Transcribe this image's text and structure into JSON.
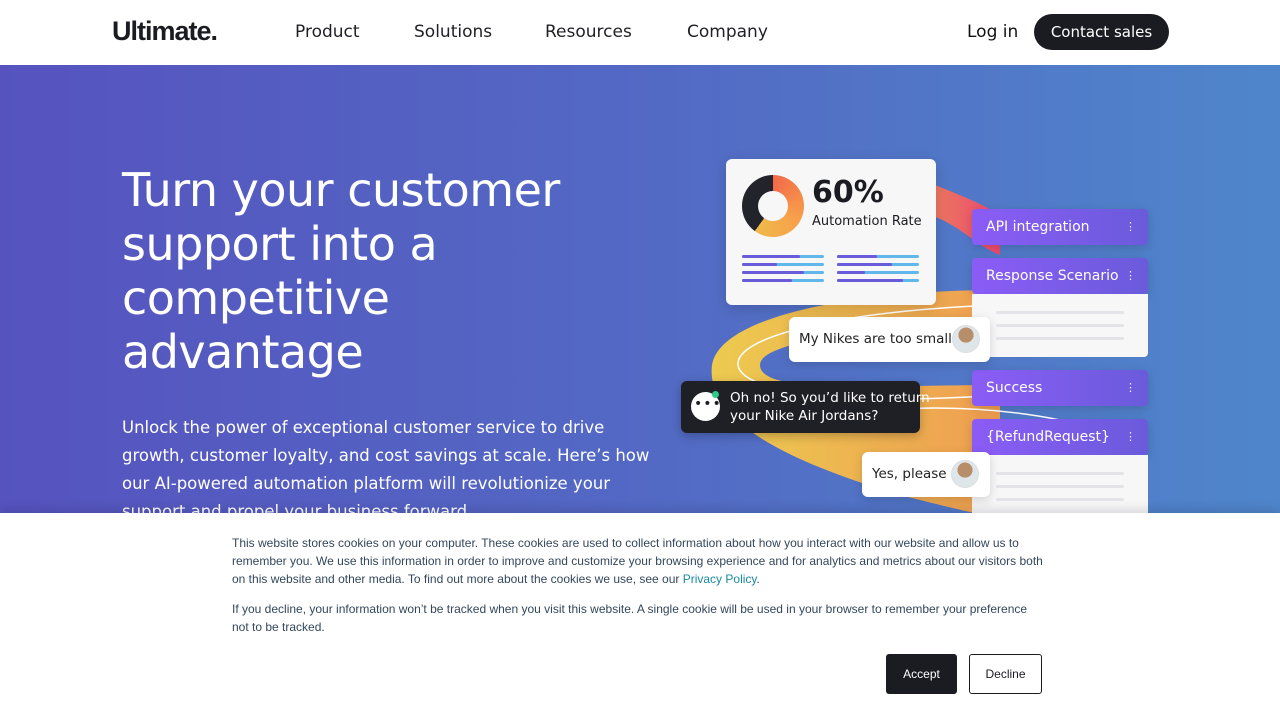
{
  "header": {
    "logo": "Ultimate.",
    "nav": [
      "Product",
      "Solutions",
      "Resources",
      "Company"
    ],
    "login": "Log in",
    "contact": "Contact sales"
  },
  "hero": {
    "headline_lines": [
      "Turn your customer",
      "support into a",
      "competitive",
      "advantage"
    ],
    "subtext_lines": [
      "Unlock the power of exceptional customer service to drive",
      "growth, customer loyalty, and cost savings at scale. Here’s how",
      "our AI-powered automation platform will revolutionize your",
      "support and propel your business forward."
    ]
  },
  "illustration": {
    "automation_percent": "60%",
    "automation_percent_value": 60,
    "automation_label": "Automation Rate",
    "flow_blocks": [
      "API integration",
      "Response Scenario",
      "Success",
      "{RefundRequest}"
    ],
    "flow_menu_icon": "⋮",
    "customer_message_1": "My Nikes are too small!",
    "bot_message_lines": [
      "Oh no! So you’d like to return",
      "your Nike Air Jordans?"
    ],
    "customer_message_2": "Yes, please",
    "colors": {
      "gradient_start": "#5653bf",
      "gradient_end": "#4f86cb",
      "flow_purple": "#8b5cf6",
      "donut_orange": "#f26a4a",
      "donut_dark": "#23232b"
    }
  },
  "cookie": {
    "text_1_before": "This website stores cookies on your computer. These cookies are used to collect information about how you interact with our website and allow us to remember you. We use this information in order to improve and customize your browsing experience and for analytics and metrics about our visitors both on this website and other media. To find out more about the cookies we use, see our ",
    "privacy_link": "Privacy Policy",
    "text_1_after": ".",
    "text_2": "If you decline, your information won’t be tracked when you visit this website. A single cookie will be used in your browser to remember your preference not to be tracked.",
    "accept": "Accept",
    "decline": "Decline"
  }
}
